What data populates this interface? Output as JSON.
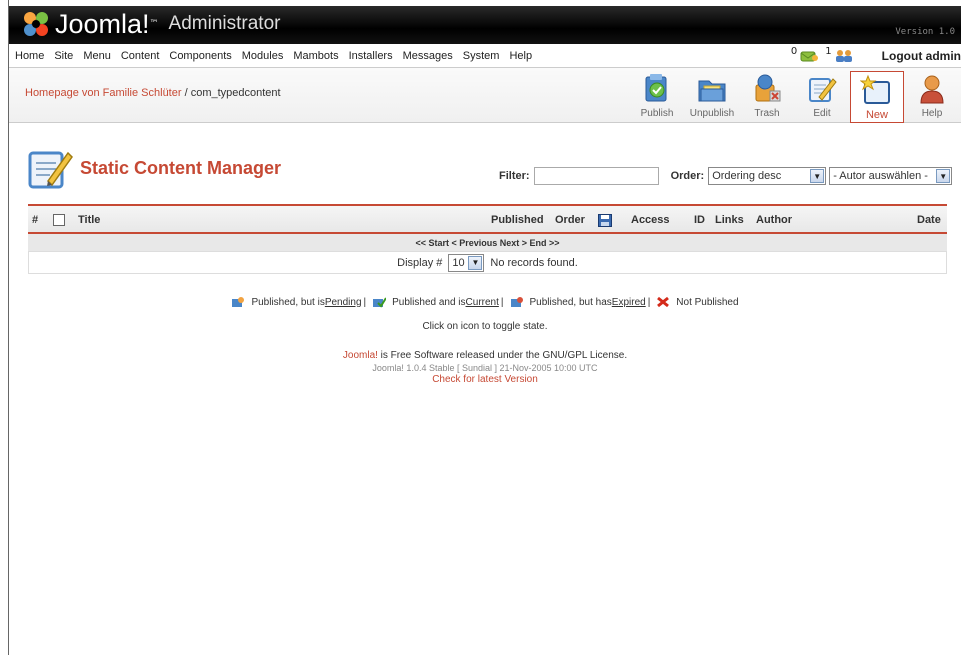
{
  "header": {
    "logo_text": "Joomla!",
    "logo_tm": "™",
    "admin_title": "Administrator",
    "version": "Version 1.0"
  },
  "menu": {
    "items": [
      "Home",
      "Site",
      "Menu",
      "Content",
      "Components",
      "Modules",
      "Mambots",
      "Installers",
      "Messages",
      "System",
      "Help"
    ],
    "messages_count": "0",
    "users_count": "1",
    "logout_label": "Logout admin"
  },
  "pathway": {
    "site": "Homepage von Familie Schlüter",
    "separator": " / ",
    "component": "com_typedcontent"
  },
  "toolbar": {
    "publish": "Publish",
    "unpublish": "Unpublish",
    "trash": "Trash",
    "edit": "Edit",
    "new": "New",
    "help": "Help"
  },
  "page": {
    "title": "Static Content Manager",
    "filter_label": "Filter:",
    "filter_value": "",
    "order_label": "Order:",
    "order_selected": "Ordering desc",
    "author_selected": "- Autor auswählen -"
  },
  "table": {
    "columns": {
      "num": "#",
      "title": "Title",
      "published": "Published",
      "order": "Order",
      "access": "Access",
      "id": "ID",
      "links": "Links",
      "author": "Author",
      "date": "Date"
    },
    "pagenav": "<< Start < Previous Next > End >>",
    "display_label": "Display #",
    "display_value": "10",
    "no_records": "No records found."
  },
  "legend": {
    "pending_prefix": "Published, but is ",
    "pending_link": "Pending",
    "current_prefix": "Published and is ",
    "current_link": "Current",
    "expired_prefix": "Published, but has ",
    "expired_link": "Expired",
    "not_published": "Not Published",
    "sep": "|",
    "hint": "Click on icon to toggle state."
  },
  "footer": {
    "joomla_link": "Joomla!",
    "license_text": " is Free Software released under the GNU/GPL License.",
    "version_line": "Joomla! 1.0.4 Stable [ Sundial ] 21-Nov-2005 10:00 UTC",
    "check_link": "Check for latest Version"
  },
  "colors": {
    "accent": "#c64934",
    "header_bg": "#000000"
  }
}
